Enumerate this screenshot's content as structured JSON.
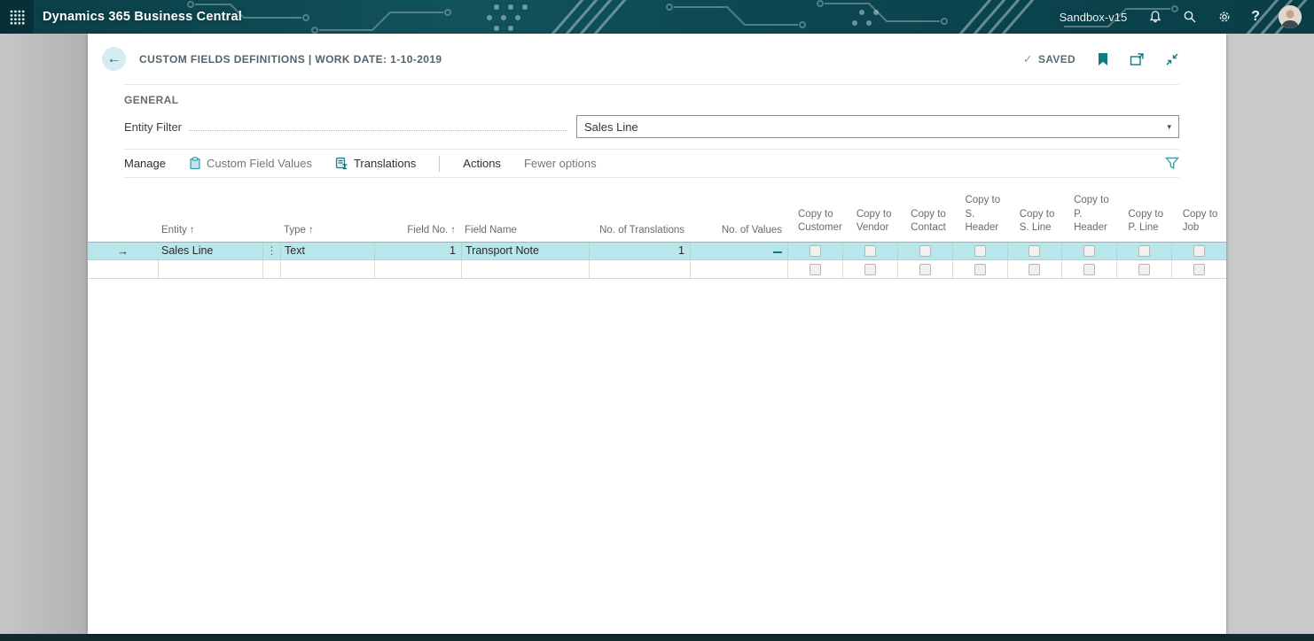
{
  "icons": {
    "back_arrow": "←",
    "row_arrow": "→",
    "ellipsis": "⋮",
    "caret_down": "▾",
    "check": "✓",
    "help": "?",
    "sort_asc": "↑"
  },
  "colors": {
    "accent_teal": "#1492a0",
    "topbar_bg": "#0b4650",
    "selected_row_bg": "#b9e6ea"
  },
  "topbar": {
    "app_title": "Dynamics 365 Business Central",
    "environment": "Sandbox-v15"
  },
  "page": {
    "title": "CUSTOM FIELDS DEFINITIONS | WORK DATE: 1-10-2019",
    "saved_label": "SAVED"
  },
  "general": {
    "section_label": "GENERAL",
    "entity_filter_label": "Entity Filter",
    "entity_filter_value": "Sales Line"
  },
  "toolbar": {
    "manage_label": "Manage",
    "custom_field_values_label": "Custom Field Values",
    "translations_label": "Translations",
    "actions_label": "Actions",
    "fewer_options_label": "Fewer options"
  },
  "table": {
    "columns": {
      "entity": "Entity",
      "type": "Type",
      "field_no": "Field No.",
      "field_name": "Field Name",
      "no_of_translations": "No. of Translations",
      "no_of_values": "No. of Values",
      "copy_prefix": "Copy to",
      "copy_targets": [
        "Customer",
        "Vendor",
        "Contact",
        "S. Header",
        "S. Line",
        "P. Header",
        "P. Line",
        "Job"
      ]
    },
    "rows": [
      {
        "entity": "Sales Line",
        "type": "Text",
        "field_no": "1",
        "field_name": "Transport Note",
        "no_of_translations": "1",
        "no_of_values": "_"
      }
    ]
  }
}
